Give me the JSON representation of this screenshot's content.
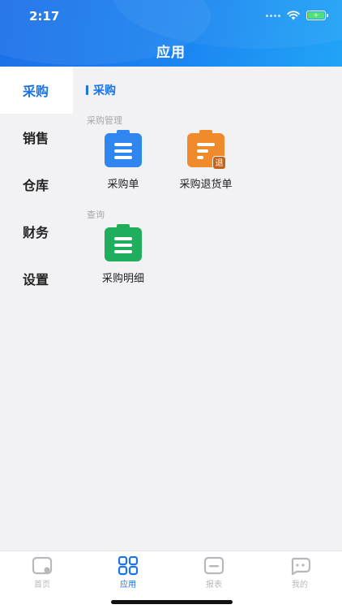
{
  "status_bar": {
    "time": "2:17",
    "battery_text": "+"
  },
  "header": {
    "title": "应用"
  },
  "sidebar": {
    "items": [
      {
        "label": "采购",
        "active": true
      },
      {
        "label": "销售",
        "active": false
      },
      {
        "label": "仓库",
        "active": false
      },
      {
        "label": "财务",
        "active": false
      },
      {
        "label": "设置",
        "active": false
      }
    ]
  },
  "main": {
    "section_title": "采购",
    "groups": [
      {
        "label": "采购管理",
        "apps": [
          {
            "label": "采购单",
            "icon": "purchase-order-icon",
            "color": "#2f86f0"
          },
          {
            "label": "采购退货单",
            "icon": "purchase-return-icon",
            "color": "#f08a2a",
            "badge": "退"
          }
        ]
      },
      {
        "label": "查询",
        "apps": [
          {
            "label": "采购明细",
            "icon": "purchase-detail-icon",
            "color": "#1fae5c"
          }
        ]
      }
    ]
  },
  "tabbar": {
    "items": [
      {
        "label": "首页",
        "icon": "home-icon",
        "active": false
      },
      {
        "label": "应用",
        "icon": "apps-grid-icon",
        "active": true
      },
      {
        "label": "报表",
        "icon": "report-icon",
        "active": false
      },
      {
        "label": "我的",
        "icon": "profile-icon",
        "active": false
      }
    ]
  },
  "colors": {
    "accent": "#1a73e8",
    "header_start": "#1c6fe8",
    "header_end": "#21a4f6"
  }
}
